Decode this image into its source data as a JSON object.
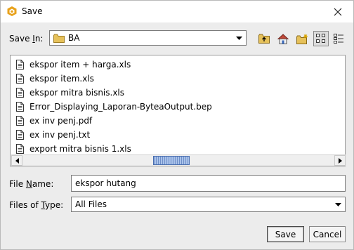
{
  "window": {
    "title": "Save",
    "icons": {
      "app": "app-logo-icon",
      "close": "close-icon"
    }
  },
  "save_in": {
    "label_prefix": "Save ",
    "label_mnemonic": "I",
    "label_suffix": "n:",
    "folder": "BA",
    "folder_icon": "folder-icon"
  },
  "toolbar": {
    "buttons": [
      {
        "name": "up-one-level",
        "icon": "folder-up-icon"
      },
      {
        "name": "home",
        "icon": "home-icon"
      },
      {
        "name": "create-new-folder",
        "icon": "new-folder-icon"
      },
      {
        "name": "list-view",
        "icon": "list-view-icon",
        "active": true
      },
      {
        "name": "details-view",
        "icon": "details-view-icon",
        "active": false
      }
    ]
  },
  "files": [
    "ekspor item + harga.xls",
    "ekspor item.xls",
    "ekspor mitra bisnis.xls",
    "Error_Displaying_Laporan-ByteaOutput.bep",
    "ex inv penj.pdf",
    "ex inv penj.txt",
    "export mitra bisnis 1.xls"
  ],
  "file_name": {
    "label_prefix": "File ",
    "label_mnemonic": "N",
    "label_suffix": "ame:",
    "value": "ekspor hutang"
  },
  "file_type": {
    "label_prefix": "Files of ",
    "label_mnemonic": "T",
    "label_suffix": "ype:",
    "selected": "All Files"
  },
  "buttons": {
    "save": "Save",
    "cancel": "Cancel"
  },
  "colors": {
    "app_icon": "#e8a21c",
    "folder": "#e6c15a",
    "scroll_thumb": "#a9c2ea"
  }
}
